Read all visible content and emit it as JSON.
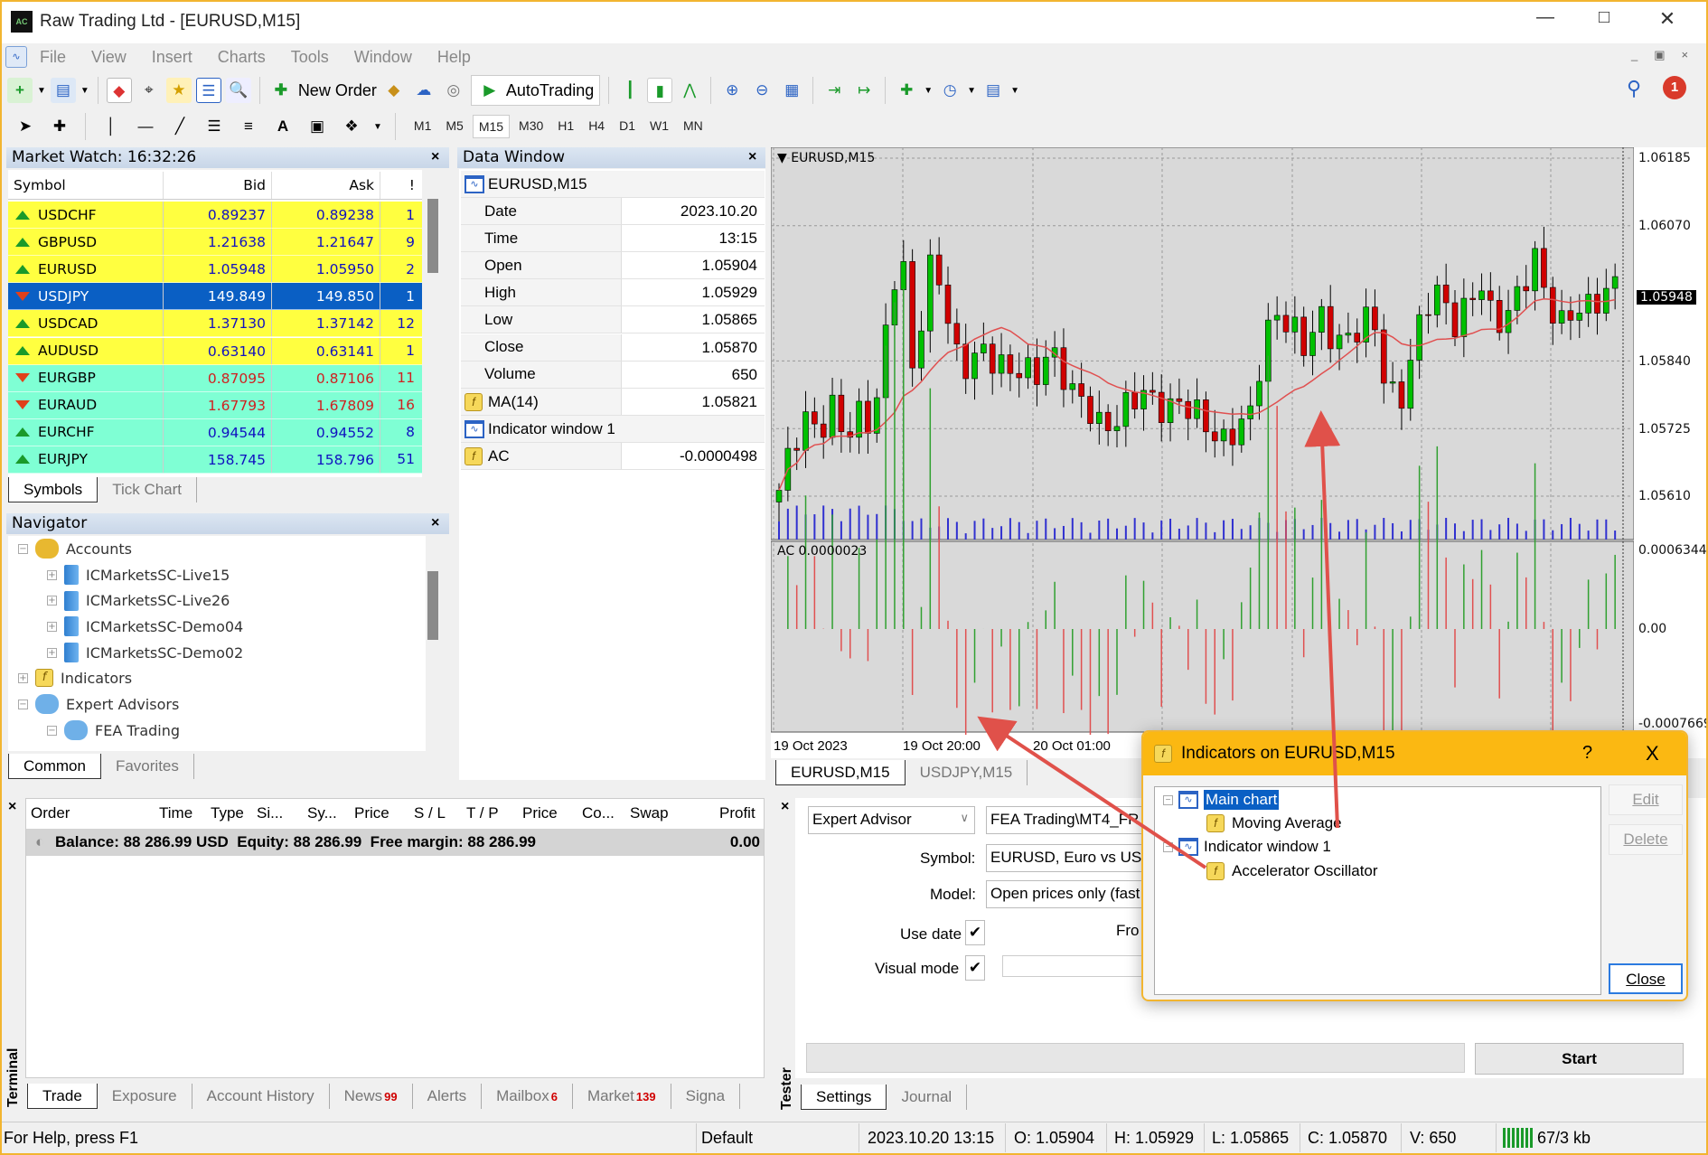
{
  "window": {
    "title": "Raw Trading Ltd - [EURUSD,M15]",
    "logo_text": "AC"
  },
  "menu": [
    "File",
    "View",
    "Insert",
    "Charts",
    "Tools",
    "Window",
    "Help"
  ],
  "toolbar": {
    "new_order": "New Order",
    "autotrading": "AutoTrading",
    "notification_count": "1",
    "timeframes": [
      "M1",
      "M5",
      "M15",
      "M30",
      "H1",
      "H4",
      "D1",
      "W1",
      "MN"
    ],
    "active_timeframe": "M15"
  },
  "market_watch": {
    "title": "Market Watch: 16:32:26",
    "columns": [
      "Symbol",
      "Bid",
      "Ask",
      "!"
    ],
    "rows": [
      {
        "symbol": "USDCHF",
        "bid": "0.89237",
        "ask": "0.89238",
        "spread": "1",
        "dir": "up",
        "bg": "#ffff40",
        "color": "#1010c0"
      },
      {
        "symbol": "GBPUSD",
        "bid": "1.21638",
        "ask": "1.21647",
        "spread": "9",
        "dir": "up",
        "bg": "#ffff40",
        "color": "#1010c0"
      },
      {
        "symbol": "EURUSD",
        "bid": "1.05948",
        "ask": "1.05950",
        "spread": "2",
        "dir": "up",
        "bg": "#ffff40",
        "color": "#1010c0"
      },
      {
        "symbol": "USDJPY",
        "bid": "149.849",
        "ask": "149.850",
        "spread": "1",
        "dir": "down",
        "bg": "#0a5fc4",
        "color": "#ffffff",
        "selected": true
      },
      {
        "symbol": "USDCAD",
        "bid": "1.37130",
        "ask": "1.37142",
        "spread": "12",
        "dir": "up",
        "bg": "#ffff40",
        "color": "#1010c0"
      },
      {
        "symbol": "AUDUSD",
        "bid": "0.63140",
        "ask": "0.63141",
        "spread": "1",
        "dir": "up",
        "bg": "#ffff40",
        "color": "#1010c0"
      },
      {
        "symbol": "EURGBP",
        "bid": "0.87095",
        "ask": "0.87106",
        "spread": "11",
        "dir": "down",
        "bg": "#7fffd4",
        "color": "#d02020"
      },
      {
        "symbol": "EURAUD",
        "bid": "1.67793",
        "ask": "1.67809",
        "spread": "16",
        "dir": "down",
        "bg": "#7fffd4",
        "color": "#d02020"
      },
      {
        "symbol": "EURCHF",
        "bid": "0.94544",
        "ask": "0.94552",
        "spread": "8",
        "dir": "up",
        "bg": "#7fffd4",
        "color": "#1010c0"
      },
      {
        "symbol": "EURJPY",
        "bid": "158.745",
        "ask": "158.796",
        "spread": "51",
        "dir": "up",
        "bg": "#7fffd4",
        "color": "#1010c0"
      }
    ],
    "tabs": [
      "Symbols",
      "Tick Chart"
    ]
  },
  "navigator": {
    "title": "Navigator",
    "accounts": "Accounts",
    "servers": [
      "ICMarketsSC-Live15",
      "ICMarketsSC-Live26",
      "ICMarketsSC-Demo04",
      "ICMarketsSC-Demo02"
    ],
    "indicators": "Indicators",
    "expert_advisors": "Expert Advisors",
    "ea": "FEA Trading",
    "tabs": [
      "Common",
      "Favorites"
    ]
  },
  "data_window": {
    "title": "Data Window",
    "symbol": "EURUSD,M15",
    "rows": [
      {
        "k": "Date",
        "v": "2023.10.20"
      },
      {
        "k": "Time",
        "v": "13:15"
      },
      {
        "k": "Open",
        "v": "1.05904"
      },
      {
        "k": "High",
        "v": "1.05929"
      },
      {
        "k": "Low",
        "v": "1.05865"
      },
      {
        "k": "Close",
        "v": "1.05870"
      },
      {
        "k": "Volume",
        "v": "650"
      }
    ],
    "ma": {
      "k": "MA(14)",
      "v": "1.05821"
    },
    "indicator_window": "Indicator window 1",
    "ac": {
      "k": "AC",
      "v": "-0.0000498"
    }
  },
  "chart": {
    "label": "EURUSD,M15",
    "ac_label": "AC 0.0000023",
    "price_ticks": [
      "1.06185",
      "1.06070",
      "1.05840",
      "1.05725",
      "1.05610"
    ],
    "current_price": "1.05948",
    "ac_ticks": [
      "0.0006344",
      "0.00",
      "-0.0007669"
    ],
    "time_ticks": [
      "19 Oct 2023",
      "19 Oct 20:00",
      "20 Oct 01:00"
    ],
    "tabs": [
      "EURUSD,M15",
      "USDJPY,M15"
    ],
    "closes": [
      1.0562,
      1.057,
      1.0574,
      1.0572,
      1.0576,
      1.0571,
      1.0575,
      1.0573,
      1.059,
      1.0605,
      1.058,
      1.06,
      1.0598,
      1.0585,
      1.0583,
      1.0586,
      1.0584,
      1.0582,
      1.0583,
      1.0581,
      1.0586,
      1.0582,
      1.0578,
      1.0576,
      1.0572,
      1.0574,
      1.0577,
      1.0579,
      1.0576,
      1.0576,
      1.0577,
      1.0575,
      1.0572,
      1.057,
      1.0573,
      1.0575,
      1.0588,
      1.0592,
      1.059,
      1.0586,
      1.0592,
      1.0588,
      1.0587,
      1.059,
      1.0592,
      1.058,
      1.0576,
      1.0586,
      1.0594,
      1.0596,
      1.059,
      1.0593,
      1.0598,
      1.059,
      1.0592,
      1.0596,
      1.0602,
      1.0594,
      1.059,
      1.0593,
      1.0593,
      1.0595,
      1.0597
    ],
    "colors": {
      "bull": "#00c000",
      "bear": "#d00000",
      "ma": "#e05050",
      "volume": "#3030d0",
      "ac_up": "#30a030",
      "ac_down": "#e05050"
    }
  },
  "terminal": {
    "label": "Terminal",
    "columns": [
      "Order",
      "Time",
      "Type",
      "Si...",
      "Sy...",
      "Price",
      "S / L",
      "T / P",
      "Price",
      "Co...",
      "Swap",
      "Profit"
    ],
    "balance": "Balance: 88 286.99 USD  Equity: 88 286.99  Free margin: 88 286.99",
    "profit": "0.00",
    "tabs": [
      {
        "label": "Trade"
      },
      {
        "label": "Exposure"
      },
      {
        "label": "Account History"
      },
      {
        "label": "News",
        "badge": "99"
      },
      {
        "label": "Alerts"
      },
      {
        "label": "Mailbox",
        "badge": "6"
      },
      {
        "label": "Market",
        "badge": "139"
      },
      {
        "label": "Signa"
      }
    ]
  },
  "tester": {
    "label": "Tester",
    "type": "Expert Advisor",
    "ea": "FEA Trading\\MT4_FR",
    "symbol_label": "Symbol:",
    "symbol": "EURUSD, Euro vs US",
    "model_label": "Model:",
    "model": "Open prices only (fast",
    "use_date": "Use date",
    "from": "Fro",
    "visual_mode": "Visual mode",
    "start": "Start",
    "tabs": [
      "Settings",
      "Journal"
    ]
  },
  "dialog": {
    "title": "Indicators on EURUSD,M15",
    "help": "?",
    "close_x": "X",
    "main_chart": "Main chart",
    "ma": "Moving Average",
    "indicator_window": "Indicator window 1",
    "ac": "Accelerator Oscillator",
    "edit": "Edit",
    "delete": "Delete",
    "close": "Close"
  },
  "statusbar": {
    "help": "For Help, press F1",
    "profile": "Default",
    "datetime": "2023.10.20 13:15",
    "open": "O: 1.05904",
    "high": "H: 1.05929",
    "low": "L: 1.05865",
    "close": "C: 1.05870",
    "volume": "V: 650",
    "traffic": "67/3 kb"
  }
}
